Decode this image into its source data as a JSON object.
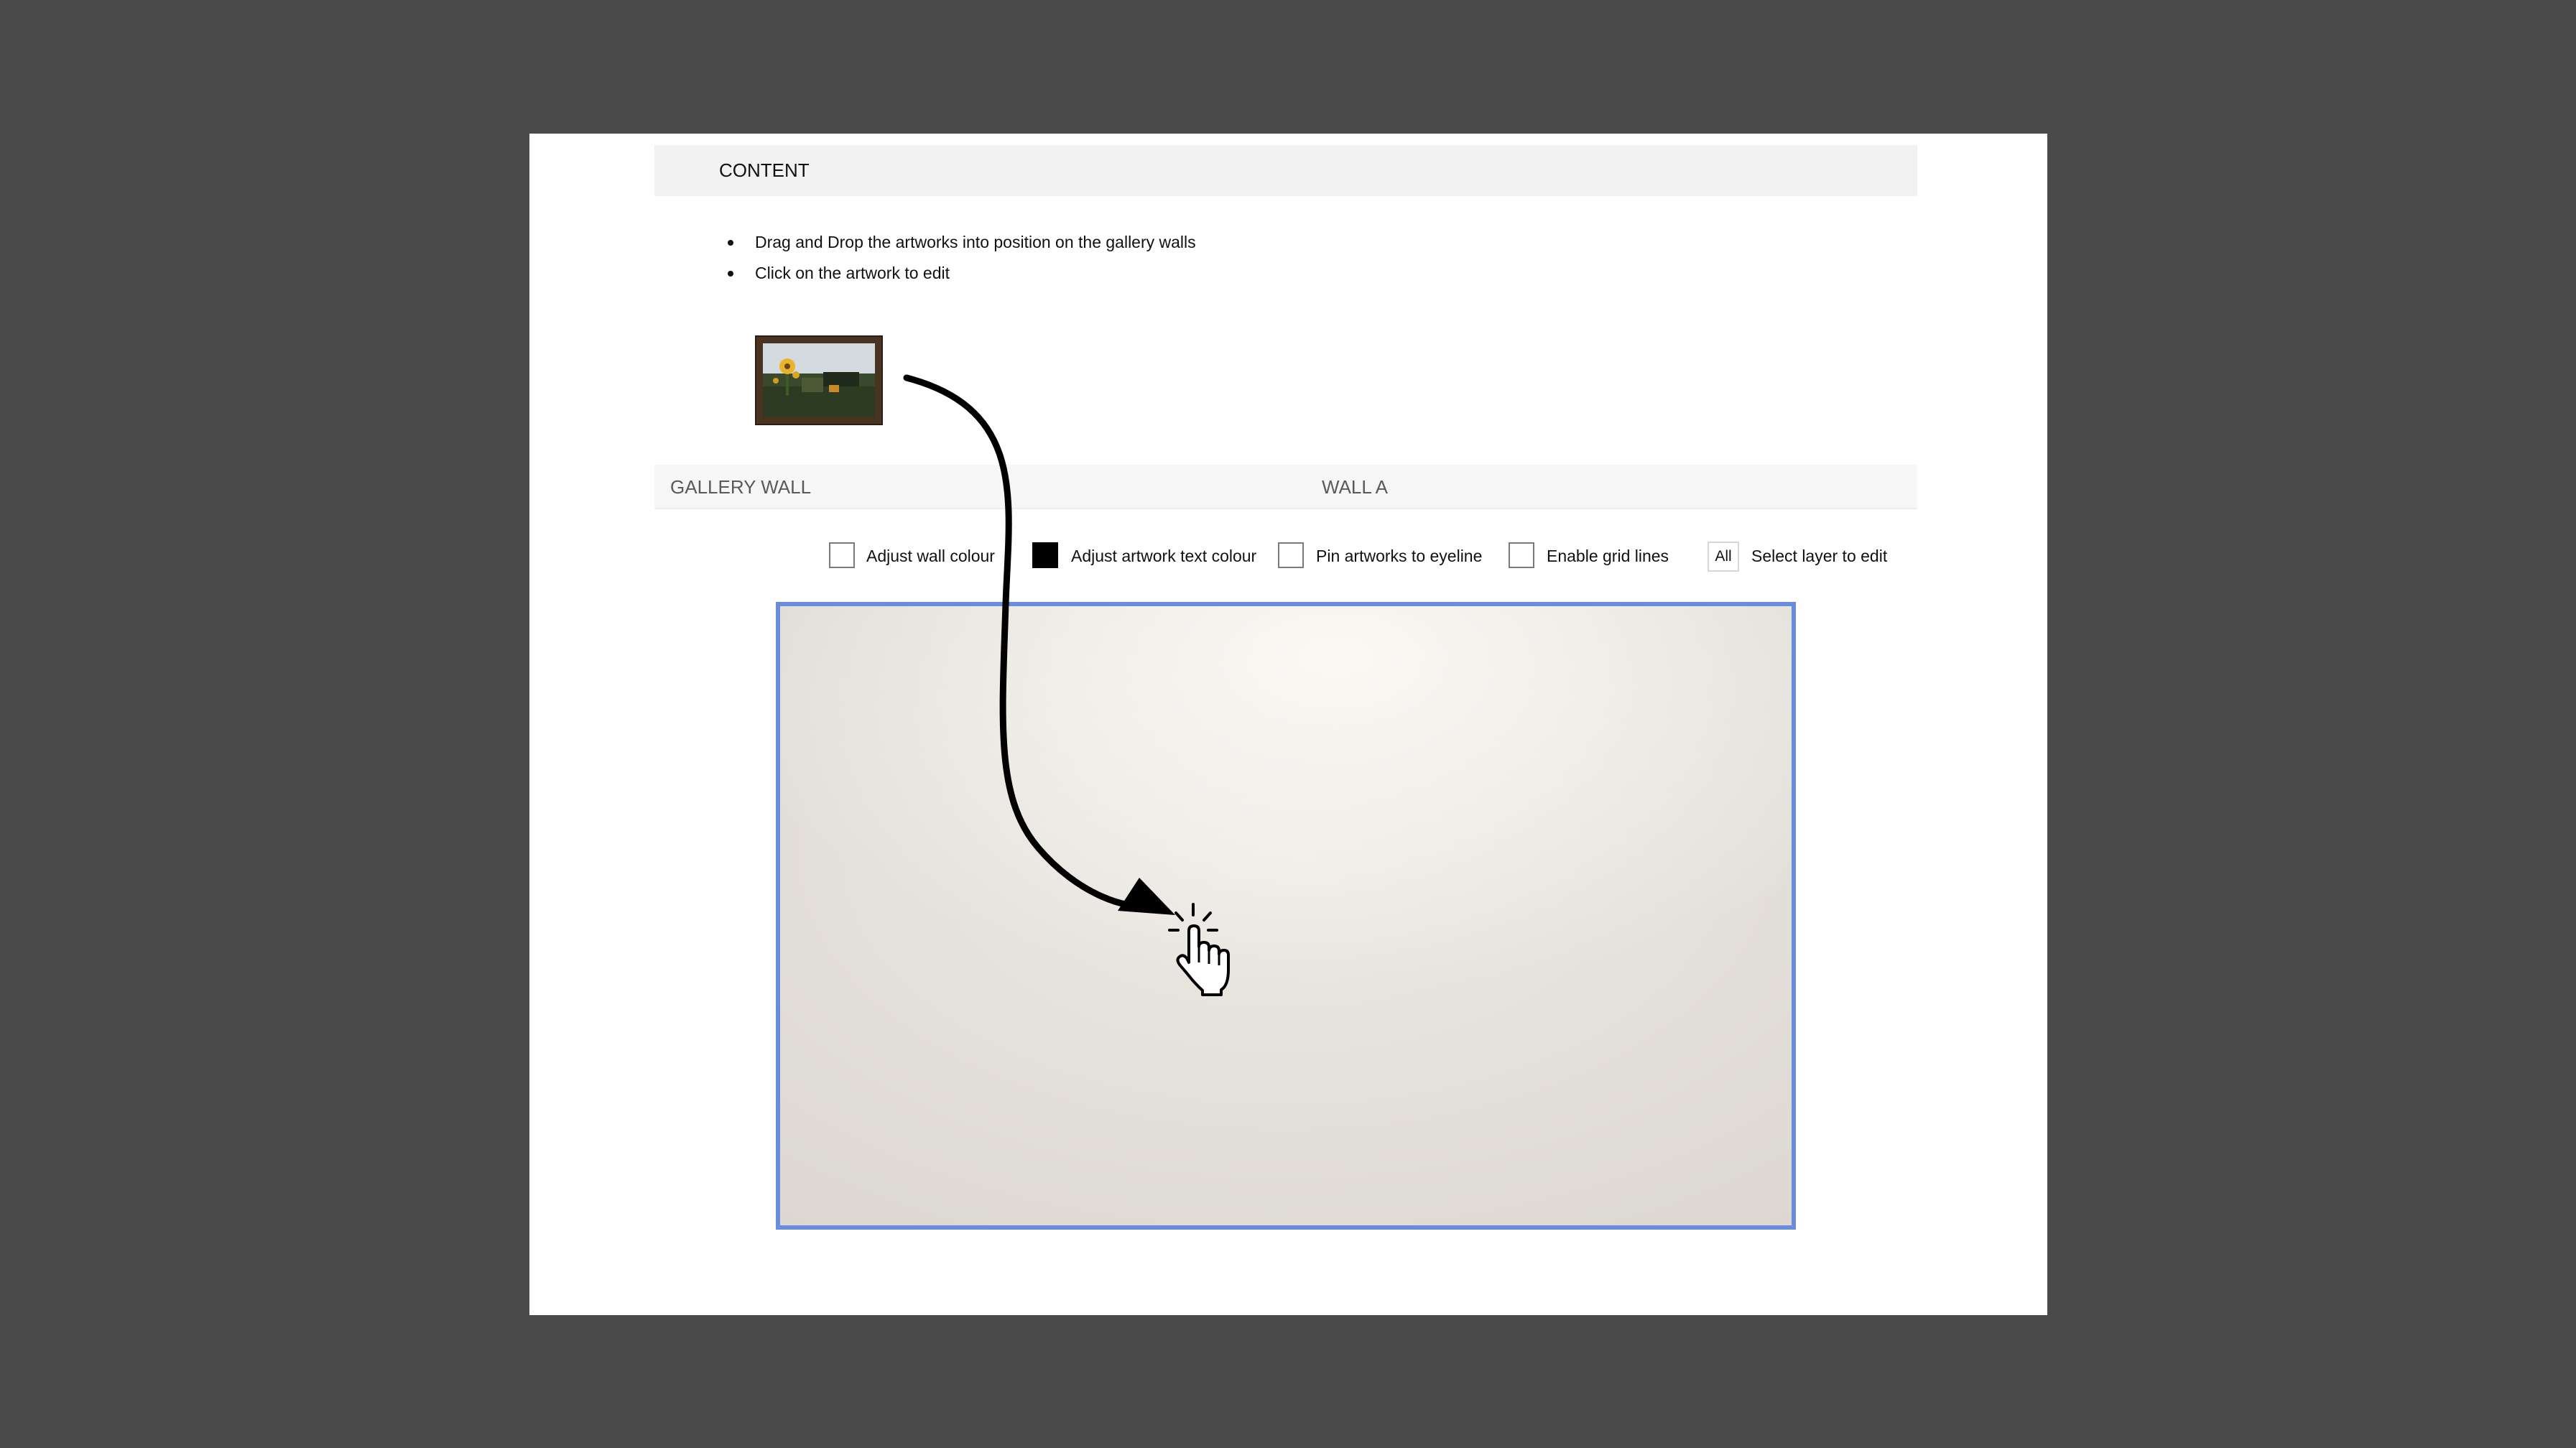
{
  "content_section": {
    "title": "CONTENT",
    "instructions": [
      "Drag and Drop the artworks into position on the gallery walls",
      "Click on the artwork to edit"
    ]
  },
  "gallery_bar": {
    "title": "GALLERY WALL",
    "wall_name": "WALL A"
  },
  "options": {
    "adjust_wall_colour": "Adjust wall colour",
    "adjust_text_colour": "Adjust artwork text colour",
    "pin_eyeline": "Pin artworks to eyeline",
    "grid_lines": "Enable grid lines",
    "layer_value": "All",
    "layer_label": "Select layer to edit"
  },
  "colors": {
    "wall_border": "#6a8ddb",
    "artwork_text_colour": "#000000",
    "frame": "#4a3321"
  },
  "icons": {
    "drag_arrow": "curved-arrow-icon",
    "cursor": "hand-pointer-click-icon"
  }
}
